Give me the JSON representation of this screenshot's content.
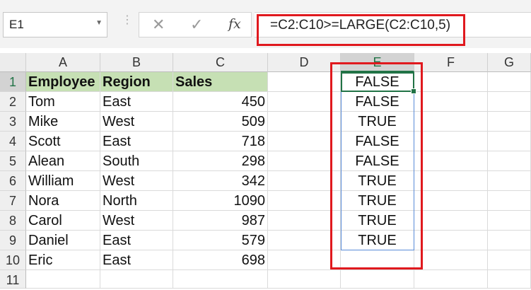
{
  "formula_bar": {
    "name_box": "E1",
    "formula": "=C2:C10>=LARGE(C2:C10,5)",
    "fx_label": "fx",
    "cancel_glyph": "✕",
    "enter_glyph": "✓"
  },
  "columns": [
    "A",
    "B",
    "C",
    "D",
    "E",
    "F",
    "G"
  ],
  "rows": [
    {
      "num": "1",
      "a": "Employee",
      "b": "Region",
      "c": "Sales",
      "e": "FALSE"
    },
    {
      "num": "2",
      "a": "Tom",
      "b": "East",
      "c": "450",
      "e": "FALSE"
    },
    {
      "num": "3",
      "a": "Mike",
      "b": "West",
      "c": "509",
      "e": "TRUE"
    },
    {
      "num": "4",
      "a": "Scott",
      "b": "East",
      "c": "718",
      "e": "FALSE"
    },
    {
      "num": "5",
      "a": "Alean",
      "b": "South",
      "c": "298",
      "e": "FALSE"
    },
    {
      "num": "6",
      "a": "William",
      "b": "West",
      "c": "342",
      "e": "TRUE"
    },
    {
      "num": "7",
      "a": "Nora",
      "b": "North",
      "c": "1090",
      "e": "TRUE"
    },
    {
      "num": "8",
      "a": "Carol",
      "b": "West",
      "c": "987",
      "e": "TRUE"
    },
    {
      "num": "9",
      "a": "Daniel",
      "b": "East",
      "c": "579",
      "e": "TRUE"
    },
    {
      "num": "10",
      "a": "Eric",
      "b": "East",
      "c": "698",
      "e": ""
    },
    {
      "num": "11",
      "a": "",
      "b": "",
      "c": "",
      "e": ""
    }
  ],
  "colors": {
    "header_fill": "#c6e0b4",
    "annotation_red": "#e0191e",
    "active_green": "#217346"
  }
}
